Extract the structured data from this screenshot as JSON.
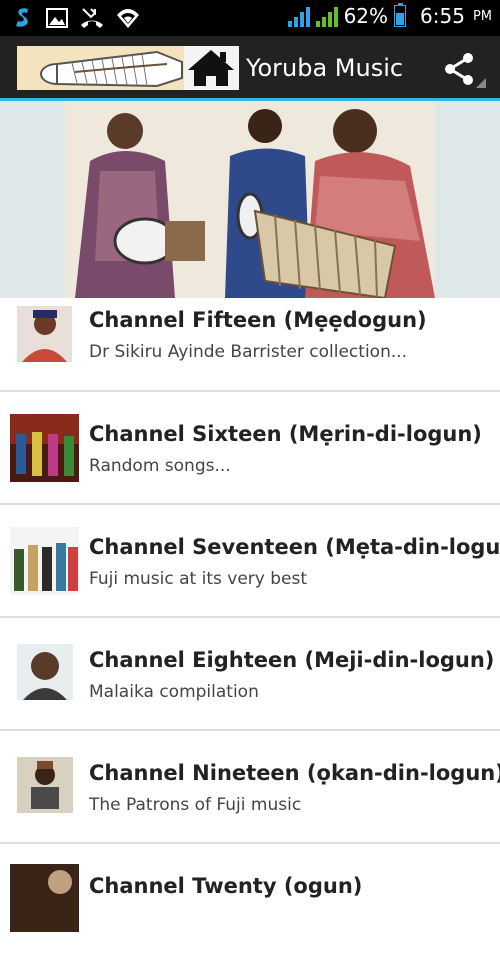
{
  "status_bar": {
    "battery_percent": "62%",
    "time": "6:55",
    "ampm": "PM",
    "icons": [
      "notification-s-icon",
      "image-icon",
      "missed-call-icon",
      "wifi-icon",
      "signal-icon",
      "signal-icon-2",
      "battery-icon"
    ]
  },
  "action_bar": {
    "title": "Yoruba Music",
    "share_icon": "share-icon",
    "home_icon": "home-icon"
  },
  "channels": [
    {
      "title": "Channel Fifteen (Mẹẹdogun)",
      "subtitle": "Dr Sikiru Ayinde Barrister collection..."
    },
    {
      "title": "Channel Sixteen (Mẹrin-di-logun)",
      "subtitle": "Random songs..."
    },
    {
      "title": "Channel Seventeen (Mẹta-din-logun)",
      "subtitle": "Fuji music at its very best"
    },
    {
      "title": "Channel Eighteen (Meji-din-logun)",
      "subtitle": "Malaika compilation"
    },
    {
      "title": "Channel Nineteen (ọkan-din-logun)",
      "subtitle": "The Patrons of Fuji music"
    },
    {
      "title": "Channel Twenty (ogun)",
      "subtitle": ""
    }
  ]
}
